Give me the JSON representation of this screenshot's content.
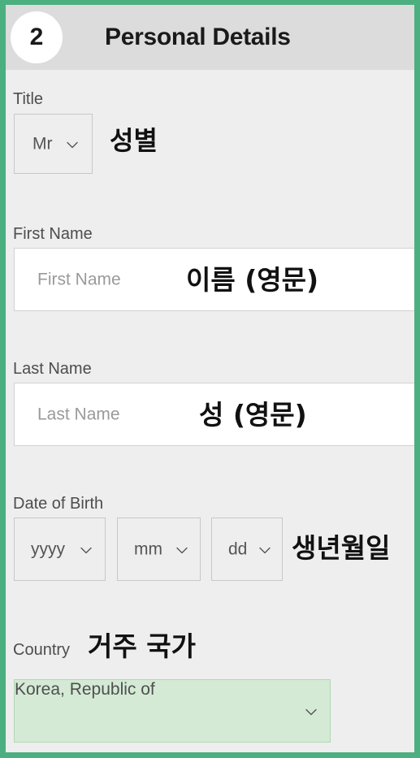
{
  "window": {
    "border_color": "#4caf80",
    "background": "#eeeeee",
    "header_background": "#dcdcdc"
  },
  "header": {
    "step_number": "2",
    "title": "Personal Details"
  },
  "fields": [
    {
      "id": "title",
      "label": "Title",
      "control": "select",
      "value": "Mr",
      "annotation": "성별"
    },
    {
      "id": "first-name",
      "label": "First Name",
      "control": "text",
      "value": "",
      "placeholder": "First Name",
      "annotation": "이름 (영문)"
    },
    {
      "id": "last-name",
      "label": "Last Name",
      "control": "text",
      "value": "",
      "placeholder": "Last Name",
      "annotation": "성 (영문)"
    },
    {
      "id": "date-of-birth",
      "label": "Date of Birth",
      "control": "select-group",
      "annotation": "생년월일",
      "parts": [
        {
          "id": "year",
          "value": "yyyy"
        },
        {
          "id": "month",
          "value": "mm"
        },
        {
          "id": "day",
          "value": "dd"
        }
      ]
    },
    {
      "id": "country",
      "label": "Country",
      "control": "select",
      "value": "Korea, Republic of",
      "annotation": "거주 국가",
      "highlight_color": "#d4ead5",
      "highlight_border": "#b2d9b6"
    }
  ],
  "icons": {
    "chevron": "chevron-down-icon"
  }
}
